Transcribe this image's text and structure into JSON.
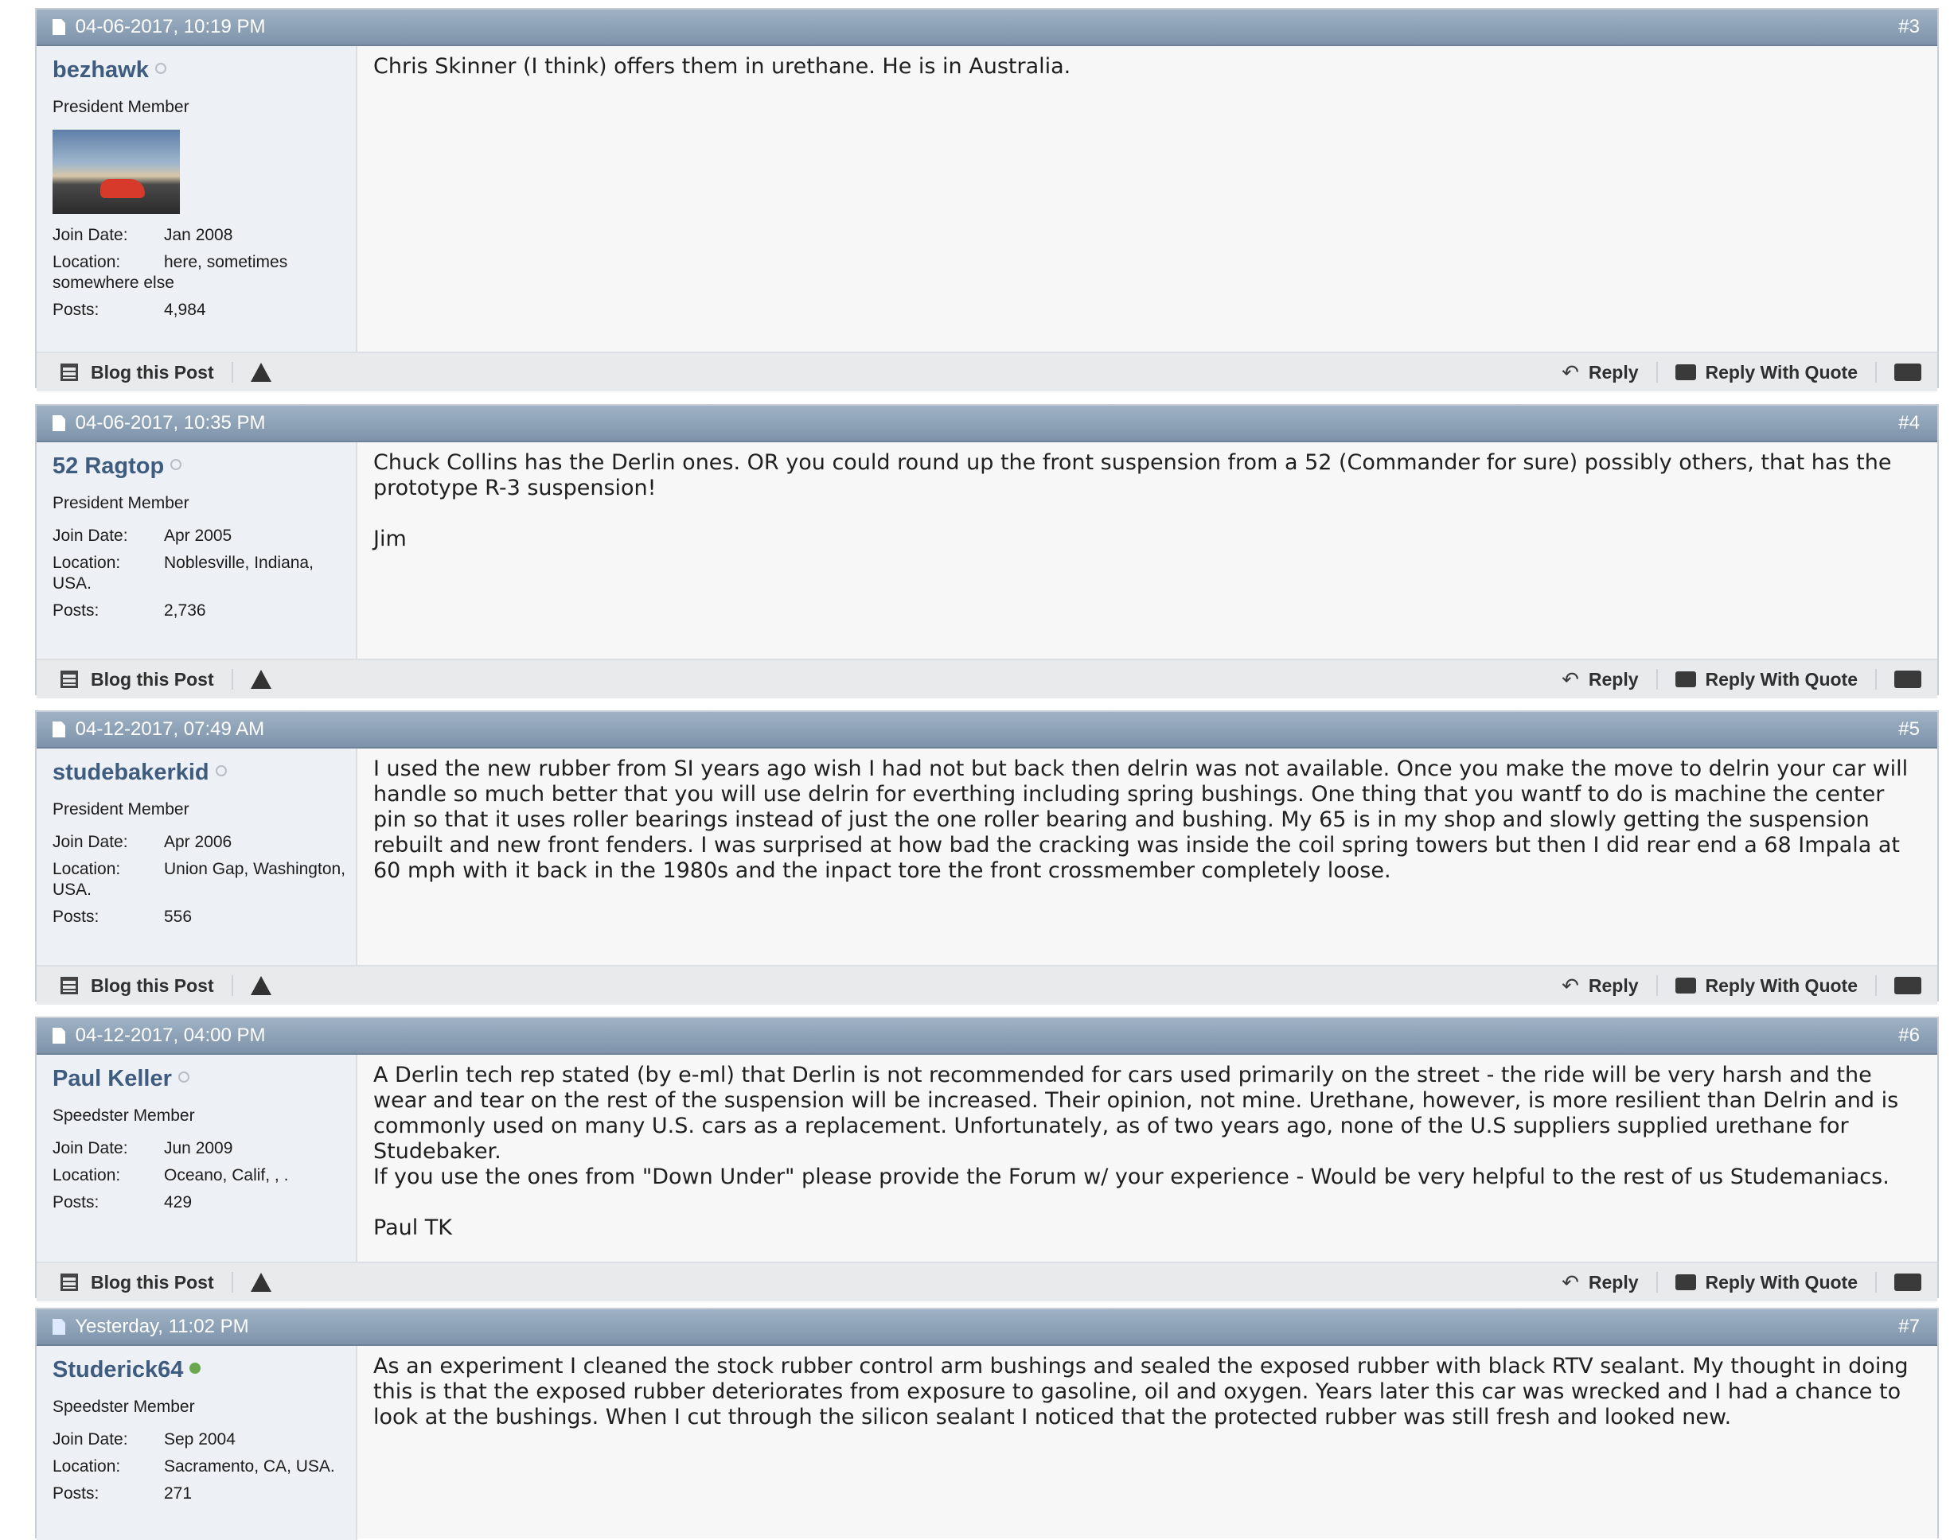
{
  "labels": {
    "join_date": "Join Date:",
    "location": "Location:",
    "posts": "Posts:"
  },
  "actions": {
    "blog": "Blog this Post",
    "reply": "Reply",
    "reply_with_quote": "Reply With Quote"
  },
  "posts": [
    {
      "date": "04-06-2017, 10:19 PM",
      "number": "#3",
      "username": "bezhawk",
      "online": false,
      "rank": "President Member",
      "has_avatar": true,
      "join_date": "Jan 2008",
      "location": "here, sometimes somewhere else",
      "post_count": "4,984",
      "message": "Chris Skinner (I think) offers them in urethane. He is in Australia."
    },
    {
      "date": "04-06-2017, 10:35 PM",
      "number": "#4",
      "username": "52 Ragtop",
      "online": false,
      "rank": "President Member",
      "has_avatar": false,
      "join_date": "Apr 2005",
      "location": "Noblesville, Indiana, USA.",
      "post_count": "2,736",
      "message": "Chuck Collins has the Derlin ones. OR you could round up the front suspension from a 52 (Commander for sure) possibly others, that has the prototype R-3 suspension!\n\nJim"
    },
    {
      "date": "04-12-2017, 07:49 AM",
      "number": "#5",
      "username": "studebakerkid",
      "online": false,
      "rank": "President Member",
      "has_avatar": false,
      "join_date": "Apr 2006",
      "location": "Union Gap, Washington, USA.",
      "post_count": "556",
      "message": "I used the new rubber from SI years ago wish I had not but back then delrin was not available. Once you make the move to delrin your car will handle so much better that you will use delrin for everthing including spring bushings. One thing that you wantf to do is machine the center pin so that it uses roller bearings instead of just the one roller bearing and bushing. My 65 is in my shop and slowly getting the suspension rebuilt and new front fenders. I was surprised at how bad the cracking was inside the coil spring towers but then I did rear end a 68 Impala at 60 mph with it back in the 1980s and the inpact tore the front crossmember completely loose."
    },
    {
      "date": "04-12-2017, 04:00 PM",
      "number": "#6",
      "username": "Paul Keller",
      "online": false,
      "rank": "Speedster Member",
      "has_avatar": false,
      "join_date": "Jun 2009",
      "location": "Oceano, Calif, , .",
      "post_count": "429",
      "message": "A Derlin tech rep stated (by e-ml) that Derlin is not recommended for cars used primarily on the street - the ride will be very harsh and the wear and tear on the rest of the suspension will be increased. Their opinion, not mine. Urethane, however, is more resilient than Delrin and is commonly used on many U.S. cars as a replacement. Unfortunately, as of two years ago, none of the U.S suppliers supplied urethane for Studebaker.\nIf you use the ones from \"Down Under\" please provide the Forum w/ your experience - Would be very helpful to the rest of us Studemaniacs.\n\nPaul TK"
    },
    {
      "date": "Yesterday, 11:02 PM",
      "number": "#7",
      "username": "Studerick64",
      "online": true,
      "rank": "Speedster Member",
      "has_avatar": false,
      "join_date": "Sep 2004",
      "location": "Sacramento, CA, USA.",
      "post_count": "271",
      "message": "As an experiment I cleaned the stock rubber control arm bushings and sealed the exposed rubber with black RTV sealant. My thought in doing this is that the exposed rubber deteriorates from exposure to gasoline, oil and oxygen. Years later this car was wrecked and I had a chance to look at the bushings. When I cut through the silicon sealant I noticed that the protected rubber was still fresh and looked new."
    }
  ]
}
